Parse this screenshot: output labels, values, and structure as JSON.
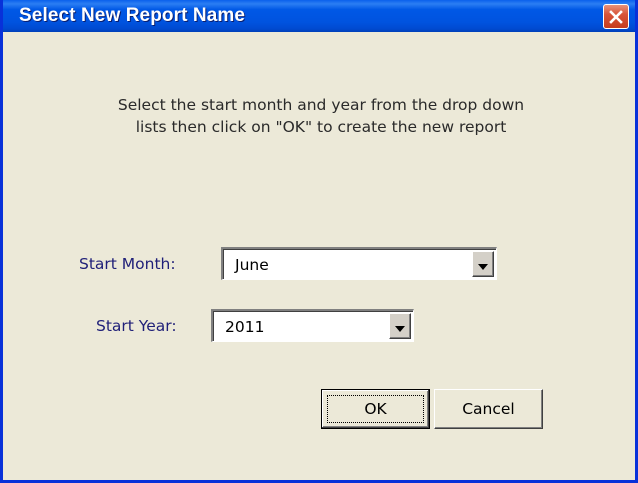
{
  "window": {
    "title": "Select New Report Name",
    "title_color": "#ffffff",
    "titlebar_color": "#0054e3",
    "close_icon": "close-icon"
  },
  "dialog": {
    "instructions_line1": "Select the start month and year from the drop down",
    "instructions_line2": "lists then click on \"OK\" to create the new report",
    "start_month": {
      "label": "Start Month:",
      "value": "June"
    },
    "start_year": {
      "label": "Start Year:",
      "value": "2011"
    },
    "buttons": {
      "ok_label": "OK",
      "cancel_label": "Cancel"
    },
    "label_color": "#1f1f78"
  }
}
